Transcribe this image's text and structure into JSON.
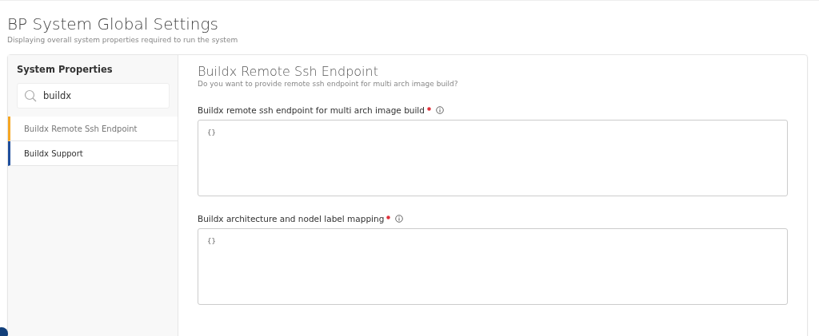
{
  "header": {
    "title": "BP System Global Settings",
    "subtitle": "Displaying overall system properties required to run the system"
  },
  "sidebar": {
    "title": "System Properties",
    "search": {
      "value": "buildx"
    },
    "items": [
      {
        "label": "Buildx Remote Ssh Endpoint",
        "selected": true,
        "color": "#f5a623"
      },
      {
        "label": "Buildx Support",
        "selected": false,
        "color": "#1f4e9c"
      }
    ]
  },
  "detail": {
    "title": "Buildx Remote Ssh Endpoint",
    "description": "Do you want to provide remote ssh endpoint for multi arch image build?",
    "fields": [
      {
        "label": "Buildx remote ssh endpoint for multi arch image build",
        "required": true,
        "value": "{}"
      },
      {
        "label": "Buildx architecture and nodel label mapping",
        "required": true,
        "value": "{}"
      }
    ]
  }
}
